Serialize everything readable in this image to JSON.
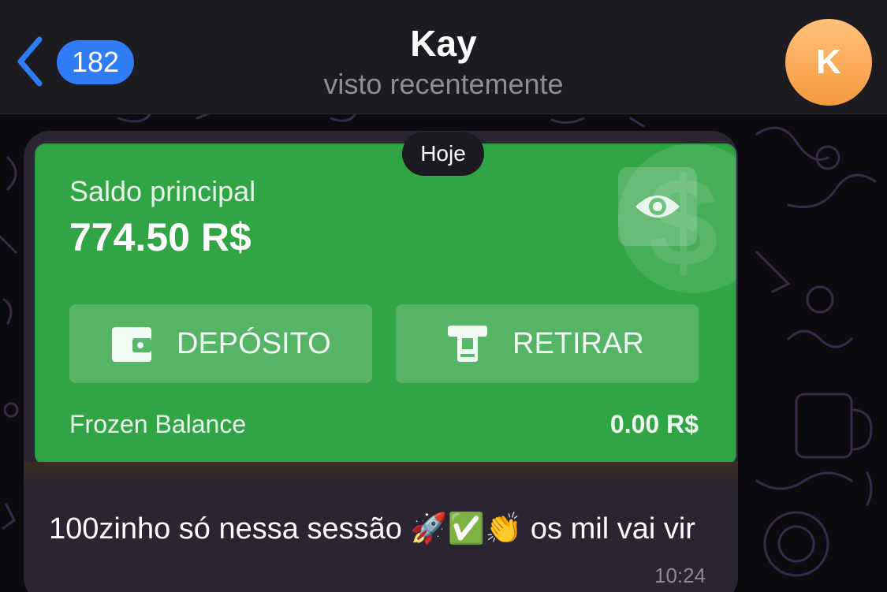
{
  "header": {
    "back_count": "182",
    "title": "Kay",
    "subtitle": "visto recentemente",
    "avatar_initial": "K",
    "avatar_color": "#f7a54a"
  },
  "chat": {
    "date_label": "Hoje",
    "message": {
      "text": "100zinho só nessa sessão 🚀✅👏 os mil vai vir",
      "time": "10:24"
    }
  },
  "screenshot_card": {
    "balance_label": "Saldo principal",
    "balance_value": "774.50 R$",
    "deposit_label": "DEPÓSITO",
    "withdraw_label": "RETIRAR",
    "frozen_label": "Frozen Balance",
    "frozen_value": "0.00 R$",
    "card_color": "#31a446",
    "icons": [
      "eye-icon",
      "wallet-icon",
      "atm-icon"
    ]
  },
  "colors": {
    "accent": "#2f7cf6",
    "bubble": "#2a2433",
    "header": "#1c1b20"
  }
}
